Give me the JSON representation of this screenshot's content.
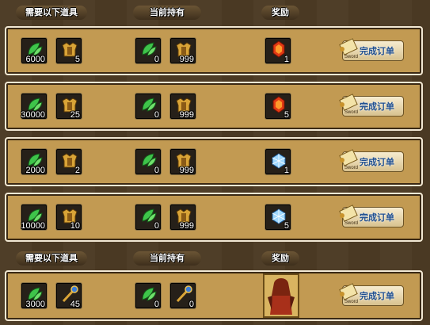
{
  "headers": {
    "required": "需要以下道具",
    "owned": "当前持有",
    "reward": "奖励"
  },
  "button_label": "完成订单",
  "button_tag": "Sword",
  "orders": [
    {
      "required": [
        {
          "icon": "green-leaf-icon",
          "count": "6000"
        },
        {
          "icon": "golden-armor-icon",
          "count": "5"
        }
      ],
      "owned": [
        {
          "icon": "green-leaf-icon",
          "count": "0"
        },
        {
          "icon": "golden-armor-icon",
          "count": "999"
        }
      ],
      "reward": {
        "icon": "red-gem-icon",
        "count": "1"
      }
    },
    {
      "required": [
        {
          "icon": "green-leaf-icon",
          "count": "30000"
        },
        {
          "icon": "golden-armor-icon",
          "count": "25"
        }
      ],
      "owned": [
        {
          "icon": "green-leaf-icon",
          "count": "0"
        },
        {
          "icon": "golden-armor-icon",
          "count": "999"
        }
      ],
      "reward": {
        "icon": "red-gem-icon",
        "count": "5"
      }
    },
    {
      "required": [
        {
          "icon": "green-leaf-icon",
          "count": "2000"
        },
        {
          "icon": "golden-armor-icon",
          "count": "2"
        }
      ],
      "owned": [
        {
          "icon": "green-leaf-icon",
          "count": "0"
        },
        {
          "icon": "golden-armor-icon",
          "count": "999"
        }
      ],
      "reward": {
        "icon": "blue-crystal-icon",
        "count": "1"
      }
    },
    {
      "required": [
        {
          "icon": "green-leaf-icon",
          "count": "10000"
        },
        {
          "icon": "golden-armor-icon",
          "count": "10"
        }
      ],
      "owned": [
        {
          "icon": "green-leaf-icon",
          "count": "0"
        },
        {
          "icon": "golden-armor-icon",
          "count": "999"
        }
      ],
      "reward": {
        "icon": "blue-crystal-icon",
        "count": "5"
      }
    },
    {
      "required": [
        {
          "icon": "green-leaf-icon",
          "count": "3000"
        },
        {
          "icon": "golden-staff-icon",
          "count": "45"
        }
      ],
      "owned": [
        {
          "icon": "green-leaf-icon",
          "count": "0"
        },
        {
          "icon": "golden-staff-icon",
          "count": "0"
        }
      ],
      "reward": {
        "icon": "character-portrait-icon",
        "count": ""
      }
    }
  ]
}
